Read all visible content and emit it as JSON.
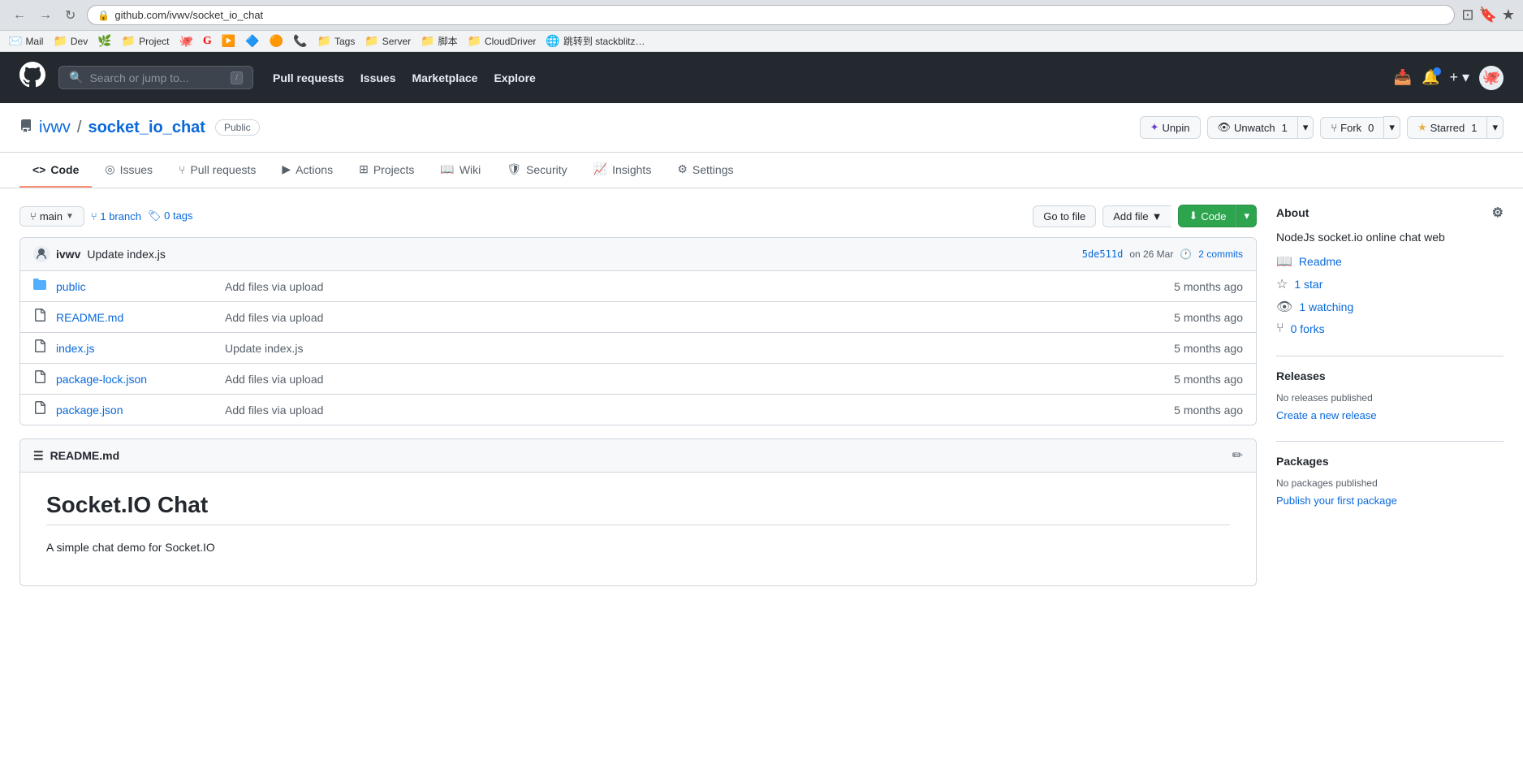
{
  "browser": {
    "url": "github.com/ivwv/socket_io_chat",
    "bookmarks": [
      {
        "icon": "✉️",
        "label": "Mail"
      },
      {
        "icon": "📁",
        "label": "Dev"
      },
      {
        "icon": "🌿",
        "label": ""
      },
      {
        "icon": "📁",
        "label": "Project"
      },
      {
        "icon": "🐙",
        "label": ""
      },
      {
        "icon": "🅶",
        "label": ""
      },
      {
        "icon": "▶️",
        "label": ""
      },
      {
        "icon": "🔷",
        "label": ""
      },
      {
        "icon": "🟠",
        "label": ""
      },
      {
        "icon": "📞",
        "label": ""
      },
      {
        "icon": "📁",
        "label": "Tags"
      },
      {
        "icon": "📁",
        "label": "Server"
      },
      {
        "icon": "📁",
        "label": "脚本"
      },
      {
        "icon": "📁",
        "label": "CloudDriver"
      },
      {
        "icon": "🌐",
        "label": "跳转到 stackblitz…"
      }
    ]
  },
  "github": {
    "search_placeholder": "Search or jump to...",
    "slash_key": "/",
    "nav": [
      {
        "label": "Pull requests"
      },
      {
        "label": "Issues"
      },
      {
        "label": "Marketplace"
      },
      {
        "label": "Explore"
      }
    ],
    "header_actions": {
      "plus_label": "+",
      "notification_label": "🔔"
    }
  },
  "repo": {
    "owner": "ivwv",
    "separator": "/",
    "name": "socket_io_chat",
    "visibility": "Public",
    "unpin_label": "Unpin",
    "unwatch_label": "Unwatch",
    "unwatch_count": "1",
    "fork_label": "Fork",
    "fork_count": "0",
    "star_label": "Starred",
    "star_count": "1"
  },
  "tabs": [
    {
      "id": "code",
      "icon": "<>",
      "label": "Code",
      "active": true
    },
    {
      "id": "issues",
      "icon": "◎",
      "label": "Issues"
    },
    {
      "id": "pull-requests",
      "icon": "⑂",
      "label": "Pull requests"
    },
    {
      "id": "actions",
      "icon": "▶",
      "label": "Actions"
    },
    {
      "id": "projects",
      "icon": "⊞",
      "label": "Projects"
    },
    {
      "id": "wiki",
      "icon": "📖",
      "label": "Wiki"
    },
    {
      "id": "security",
      "icon": "🛡",
      "label": "Security"
    },
    {
      "id": "insights",
      "icon": "📈",
      "label": "Insights"
    },
    {
      "id": "settings",
      "icon": "⚙",
      "label": "Settings"
    }
  ],
  "branch": {
    "current": "main",
    "branch_count": "1",
    "branch_label": "branch",
    "tag_count": "0",
    "tag_label": "tags",
    "go_to_file": "Go to file",
    "add_file": "Add file",
    "code_label": "Code"
  },
  "commit": {
    "avatar_icon": "👤",
    "author": "ivwv",
    "message": "Update index.js",
    "hash": "5de511d",
    "date": "on 26 Mar",
    "clock_icon": "🕐",
    "commits_count": "2",
    "commits_label": "commits"
  },
  "files": [
    {
      "type": "folder",
      "icon": "📁",
      "name": "public",
      "commit_msg": "Add files via upload",
      "age": "5 months ago"
    },
    {
      "type": "file",
      "icon": "📄",
      "name": "README.md",
      "commit_msg": "Add files via upload",
      "age": "5 months ago"
    },
    {
      "type": "file",
      "icon": "📄",
      "name": "index.js",
      "commit_msg": "Update index.js",
      "age": "5 months ago"
    },
    {
      "type": "file",
      "icon": "📄",
      "name": "package-lock.json",
      "commit_msg": "Add files via upload",
      "age": "5 months ago"
    },
    {
      "type": "file",
      "icon": "📄",
      "name": "package.json",
      "commit_msg": "Add files via upload",
      "age": "5 months ago"
    }
  ],
  "readme": {
    "icon": "☰",
    "title": "README.md",
    "edit_icon": "✏",
    "heading": "Socket.IO Chat",
    "description": "A simple chat demo for Socket.IO"
  },
  "about": {
    "title": "About",
    "gear_icon": "⚙",
    "description": "NodeJs socket.io online chat web",
    "readme_label": "Readme",
    "star_label": "1 star",
    "watching_label": "1 watching",
    "forks_label": "0 forks"
  },
  "releases": {
    "title": "Releases",
    "no_releases": "No releases published",
    "create_link": "Create a new release"
  },
  "packages": {
    "title": "Packages",
    "no_packages": "No packages published",
    "publish_link": "Publish your first package"
  }
}
